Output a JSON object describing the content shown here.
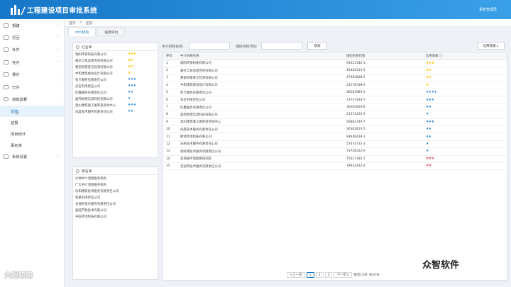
{
  "app": {
    "title": "工程建设项目审批系统",
    "user": "系统管理员"
  },
  "sidebar": {
    "items": [
      {
        "label": "报建"
      },
      {
        "label": "打回"
      },
      {
        "label": "补件"
      },
      {
        "label": "在办"
      },
      {
        "label": "督办"
      },
      {
        "label": "已办"
      },
      {
        "label": "效能监督"
      }
    ],
    "subitems": [
      {
        "label": "监管"
      },
      {
        "label": "监督"
      },
      {
        "label": "项目统计"
      },
      {
        "label": "黑名单"
      }
    ],
    "settings": {
      "label": "系统设置"
    }
  },
  "breadcrumb": {
    "home": "首页",
    "sep": ">",
    "current": "监管"
  },
  "tabs": [
    {
      "label": "中介机构"
    },
    {
      "label": "报建单位"
    }
  ],
  "red_list": {
    "title": "红名单",
    "rows": [
      {
        "name": "瑞阳环保科技有限公司",
        "level": "♛♛♛",
        "cls": "crown"
      },
      {
        "name": "通达工程监理咨询有限公司",
        "level": "♛♛",
        "cls": "crown"
      },
      {
        "name": "惠安防雷安全检测有限公司",
        "level": "♛♛",
        "cls": "crown"
      },
      {
        "name": "中和建筑规划设计有限公司",
        "level": "♛",
        "cls": "crown"
      },
      {
        "name": "科卡服务有限责任公司",
        "level": "♦♦♦",
        "cls": "gem"
      },
      {
        "name": "多宝有限责任公司",
        "level": "♦♦♦",
        "cls": "gem"
      },
      {
        "name": "红鑫服务有限责任公司",
        "level": "♦♦",
        "cls": "gem"
      },
      {
        "name": "盛邦地理信息科技有限公司",
        "level": "♦",
        "cls": "gem"
      },
      {
        "name": "温州建筑施工图审查咨询中心",
        "level": "♦♦♦",
        "cls": "gem"
      },
      {
        "name": "风度技术服务有限责任公司",
        "level": "♦♦",
        "cls": "gem"
      }
    ]
  },
  "black_list": {
    "title": "黑名单",
    "rows": [
      {
        "name": "大地中介测绘服务机构"
      },
      {
        "name": "广大中介测绘服务机构"
      },
      {
        "name": "乐和建筑技术服务有限责任公司"
      },
      {
        "name": "利豪有限责任公司"
      },
      {
        "name": "多保利技术服务有限责任公司"
      },
      {
        "name": "超越节能技术有限公司"
      },
      {
        "name": "中国环境科技有限公司"
      }
    ]
  },
  "filter": {
    "name_label": "中介机构名称:",
    "code_label": "组织机构代码:",
    "search": "搜索",
    "rank_label": "信用等级↓"
  },
  "table": {
    "headers": {
      "no": "序号",
      "name": "中介机构名称",
      "code": "组织机构代码",
      "level": "信用等级 ⓘ"
    },
    "rows": [
      {
        "no": "1",
        "name": "瑞阳环保科技有限公司",
        "code": "93521342-3",
        "level": "♛♛♛",
        "cls": "crown"
      },
      {
        "no": "2",
        "name": "通达工程监理咨询有限公司",
        "code": "45426113-5",
        "level": "♛♛",
        "cls": "crown"
      },
      {
        "no": "3",
        "name": "惠安防雷安全检测有限公司",
        "code": "47483828-2",
        "level": "♛♛",
        "cls": "crown"
      },
      {
        "no": "4",
        "name": "中和建筑规划设计有限公司",
        "code": "23178338-6",
        "level": "♛",
        "cls": "crown"
      },
      {
        "no": "5",
        "name": "科卡服务有限责任公司",
        "code": "36283983-1",
        "level": "♦♦♦♦",
        "cls": "gem"
      },
      {
        "no": "6",
        "name": "多宝有限责任公司",
        "code": "73737293-7",
        "level": "♦♦♦",
        "cls": "gem"
      },
      {
        "no": "7",
        "name": "红鑫服务有限责任公司",
        "code": "36362834-8",
        "level": "♦♦",
        "cls": "gem"
      },
      {
        "no": "8",
        "name": "盛邦地理信息科技有限公司",
        "code": "21574233-6",
        "level": "♦",
        "cls": "gem"
      },
      {
        "no": "9",
        "name": "温州建筑施工图审查咨询中心",
        "code": "56882340-7",
        "level": "♦♦♦",
        "cls": "gem"
      },
      {
        "no": "10",
        "name": "风度技术服务有限责任公司",
        "code": "36362813-5",
        "level": "♦♦",
        "cls": "gem"
      },
      {
        "no": "11",
        "name": "捷瑞环境科技有限公司",
        "code": "94848438-1",
        "level": "♦♦",
        "cls": "gem"
      },
      {
        "no": "12",
        "name": "乐民技术服务有限责任公司",
        "code": "57474732-3",
        "level": "♦",
        "cls": "gem"
      },
      {
        "no": "13",
        "name": "瑞好德技术服务有限责任公司",
        "code": "73728312-6",
        "level": "♦",
        "cls": "gem"
      },
      {
        "no": "14",
        "name": "首地质环境勘察研究院",
        "code": "75437392-7",
        "level": "♥♥♥",
        "cls": "heart"
      },
      {
        "no": "15",
        "name": "宣宣筑技术服务有限责任公司",
        "code": "78932432-4",
        "level": "♥♥",
        "cls": "heart"
      }
    ]
  },
  "pager": {
    "prev": "<上一页",
    "p1": "1",
    "p2": "2",
    "p3": "3",
    "next": "下一页>",
    "size": "每页15条",
    "total": "共35条"
  },
  "watermarks": {
    "left": "大眼鲸鲸",
    "right": "众智软件"
  },
  "colors": {
    "header": "#1677c8",
    "accent": "#1677c8"
  }
}
